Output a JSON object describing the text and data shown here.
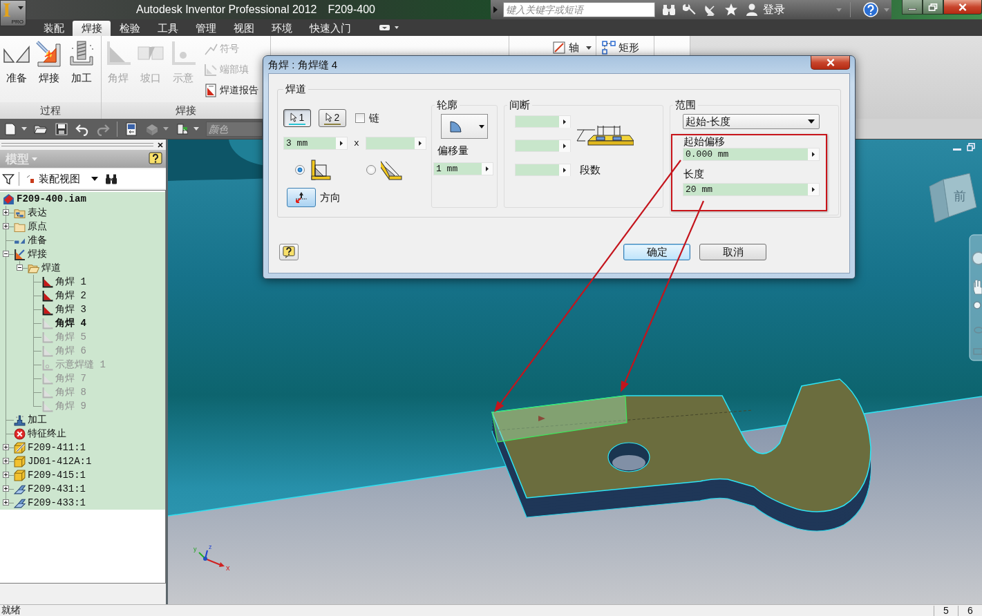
{
  "window": {
    "title": "Autodesk Inventor Professional 2012",
    "document": "F209-400"
  },
  "app_button": {
    "logo": "I",
    "edition": "PRO"
  },
  "help_bar": {
    "search": {
      "placeholder": "键入关键字或短语"
    },
    "sign_in": "登录"
  },
  "ribbon_tabs": [
    {
      "label": "装配",
      "selected": false
    },
    {
      "label": "焊接",
      "selected": true
    },
    {
      "label": "检验",
      "selected": false
    },
    {
      "label": "工具",
      "selected": false
    },
    {
      "label": "管理",
      "selected": false
    },
    {
      "label": "视图",
      "selected": false
    },
    {
      "label": "环境",
      "selected": false
    },
    {
      "label": "快速入门",
      "selected": false
    }
  ],
  "ribbon": {
    "panels": [
      {
        "title": "过程",
        "large_buttons": [
          {
            "label": "准备",
            "disabled": false
          },
          {
            "label": "焊接",
            "disabled": false
          },
          {
            "label": "加工",
            "disabled": false
          }
        ]
      },
      {
        "title": "焊接",
        "large_buttons": [
          {
            "label": "角焊",
            "disabled": true
          },
          {
            "label": "坡口",
            "disabled": true
          },
          {
            "label": "示意",
            "disabled": true
          }
        ],
        "small_buttons": [
          {
            "label": "符号",
            "disabled": true
          },
          {
            "label": "端部填",
            "disabled": true
          },
          {
            "label": "焊道报告",
            "disabled": false
          }
        ]
      }
    ],
    "covered_items": [
      "轴",
      "矩形"
    ]
  },
  "quick_access": {
    "appearance": {
      "placeholder": "颜色"
    }
  },
  "browser": {
    "title": "模型",
    "view": "装配视图",
    "root": {
      "label": "F209-400.iam",
      "kind": "assembly",
      "children": [
        {
          "label": "表达",
          "kind": "representations",
          "expanded": false,
          "active": false,
          "suppressed": false
        },
        {
          "label": "原点",
          "kind": "folder",
          "expanded": false,
          "active": false,
          "suppressed": false
        },
        {
          "label": "准备",
          "kind": "preparation",
          "active": false,
          "suppressed": false
        },
        {
          "label": "焊接",
          "kind": "weldment",
          "expanded": true,
          "active": false,
          "suppressed": false,
          "children": [
            {
              "label": "焊道",
              "kind": "folder-open",
              "expanded": true,
              "active": false,
              "suppressed": false,
              "children": [
                {
                  "label": "角焊 1",
                  "kind": "fillet-weld",
                  "active": false,
                  "suppressed": false
                },
                {
                  "label": "角焊 2",
                  "kind": "fillet-weld",
                  "active": false,
                  "suppressed": false
                },
                {
                  "label": "角焊 3",
                  "kind": "fillet-weld",
                  "active": false,
                  "suppressed": false
                },
                {
                  "label": "角焊 4",
                  "kind": "fillet-weld",
                  "active": true,
                  "suppressed": false
                },
                {
                  "label": "角焊 5",
                  "kind": "fillet-weld",
                  "active": false,
                  "suppressed": true
                },
                {
                  "label": "角焊 6",
                  "kind": "fillet-weld",
                  "active": false,
                  "suppressed": true
                },
                {
                  "label": "示意焊缝 1",
                  "kind": "cosmetic-weld",
                  "active": false,
                  "suppressed": true
                },
                {
                  "label": "角焊 7",
                  "kind": "fillet-weld",
                  "active": false,
                  "suppressed": true
                },
                {
                  "label": "角焊 8",
                  "kind": "fillet-weld",
                  "active": false,
                  "suppressed": true
                },
                {
                  "label": "角焊 9",
                  "kind": "fillet-weld",
                  "active": false,
                  "suppressed": true
                }
              ]
            }
          ]
        },
        {
          "label": "加工",
          "kind": "machining",
          "active": false,
          "suppressed": false
        },
        {
          "label": "特征终止",
          "kind": "end-of-features",
          "active": false,
          "suppressed": false
        },
        {
          "label": "F209-411:1",
          "kind": "weldment-part",
          "expanded": false,
          "active": false,
          "suppressed": false
        },
        {
          "label": "JD01-412A:1",
          "kind": "part",
          "expanded": false,
          "active": false,
          "suppressed": false
        },
        {
          "label": "F209-415:1",
          "kind": "part",
          "expanded": false,
          "active": false,
          "suppressed": false
        },
        {
          "label": "F209-431:1",
          "kind": "sheet-metal-part",
          "expanded": false,
          "active": false,
          "suppressed": false
        },
        {
          "label": "F209-433:1",
          "kind": "sheet-metal-part",
          "expanded": false,
          "active": false,
          "suppressed": false
        }
      ]
    }
  },
  "viewport": {
    "view_cube_face": "前",
    "axis_labels": [
      "x",
      "y",
      "z"
    ]
  },
  "dialog": {
    "title": "角焊 : 角焊缝 4",
    "bead": {
      "title": "焊道",
      "selectors": [
        {
          "label": "1",
          "selected": true,
          "color": "#27c4d4"
        },
        {
          "label": "2",
          "selected": false,
          "color": "#8b8040"
        }
      ],
      "chain": {
        "label": "链",
        "checked": false
      },
      "leg_1": "3 mm",
      "times": "x",
      "shapes": [
        {
          "selected": true
        },
        {
          "selected": false
        }
      ],
      "direction": "方向"
    },
    "contour": {
      "title": "轮廓",
      "offset_label": "偏移量",
      "offset": "1 mm"
    },
    "intermittent": {
      "title": "间断",
      "count_label": "段数"
    },
    "extents": {
      "title": "范围",
      "mode": "起始-长度",
      "start_offset_label": "起始偏移",
      "start_offset": "0.000 mm",
      "length_label": "长度",
      "length": "20 mm"
    },
    "buttons": [
      {
        "label": "确定",
        "default": true
      },
      {
        "label": "取消",
        "default": false
      }
    ]
  },
  "status_bar": {
    "message": "就绪",
    "cells": [
      "5",
      "6"
    ]
  }
}
